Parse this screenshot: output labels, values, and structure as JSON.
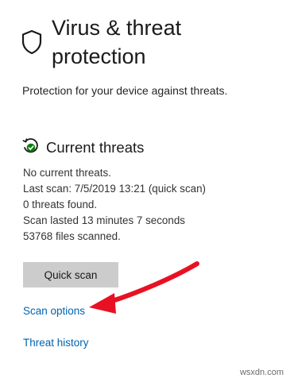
{
  "header": {
    "title": "Virus & threat protection",
    "subtitle": "Protection for your device against threats.",
    "icon": "shield-icon"
  },
  "current_threats": {
    "title": "Current threats",
    "icon": "clock-check-icon",
    "icon_color": "#107c10",
    "lines": [
      "No current threats.",
      "Last scan: 7/5/2019 13:21 (quick scan)",
      "0 threats found.",
      "Scan lasted 13 minutes 7 seconds",
      "53768 files scanned."
    ],
    "quick_scan_label": "Quick scan",
    "scan_options_label": "Scan options",
    "threat_history_label": "Threat history"
  },
  "annotation": {
    "arrow_color": "#e81123"
  },
  "watermark": "wsxdn.com",
  "colors": {
    "link": "#0063b1",
    "button_bg": "#cccccc"
  }
}
